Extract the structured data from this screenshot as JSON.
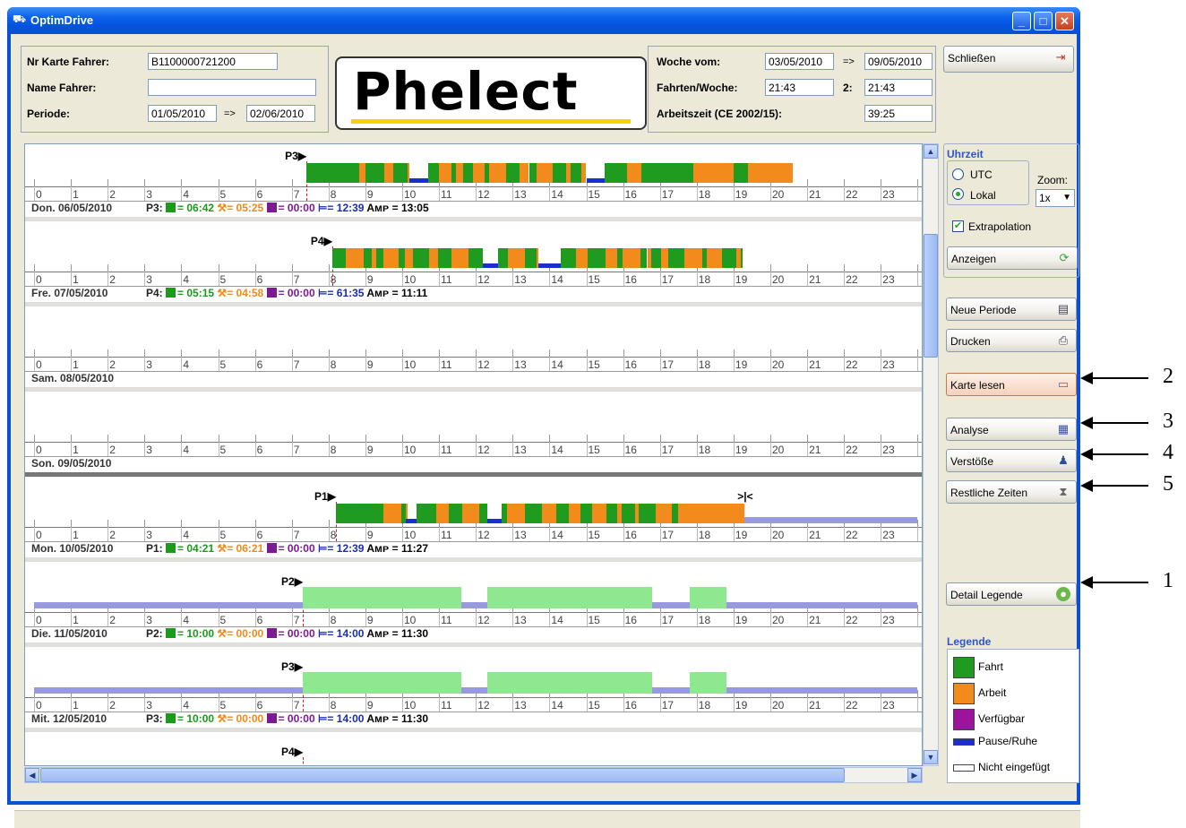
{
  "window": {
    "title": "OptimDrive"
  },
  "header": {
    "card_label": "Nr Karte Fahrer:",
    "card_value": "B1100000721200",
    "name_label": "Name Fahrer:",
    "name_value": "",
    "period_label": "Periode:",
    "period_from": "01/05/2010",
    "period_arrow": "=>",
    "period_to": "02/06/2010",
    "logo_text": "Phelect",
    "week_label": "Woche vom:",
    "week_from": "03/05/2010",
    "week_arrow": "=>",
    "week_to": "09/05/2010",
    "trips_label": "Fahrten/Woche:",
    "trips_value": "21:43",
    "trips2_label": "2:",
    "trips2_value": "21:43",
    "work_label": "Arbeitszeit (CE 2002/15):",
    "work_value": "39:25"
  },
  "sidebar": {
    "close_label": "Schließen",
    "uhrzeit_title": "Uhrzeit",
    "utc_label": "UTC",
    "lokal_label": "Lokal",
    "zoom_label": "Zoom:",
    "zoom_value": "1x",
    "extrapolation_label": "Extrapolation",
    "show_label": "Anzeigen",
    "new_period_label": "Neue Periode",
    "print_label": "Drucken",
    "read_card_label": "Karte lesen",
    "analysis_label": "Analyse",
    "violations_label": "Verstöße",
    "remaining_label": "Restliche Zeiten",
    "detail_legend_label": "Detail Legende",
    "legend_title": "Legende",
    "legend": [
      {
        "label": "Fahrt",
        "color": "#1f9b1f"
      },
      {
        "label": "Arbeit",
        "color": "#f28a1c"
      },
      {
        "label": "Verfügbar",
        "color": "#9b149b"
      },
      {
        "label": "Pause/Ruhe",
        "color": "#1a2fd0"
      },
      {
        "label": "Nicht eingefügt",
        "color": "#ffffff"
      }
    ]
  },
  "hours": [
    "0",
    "1",
    "2",
    "3",
    "4",
    "5",
    "6",
    "7",
    "8",
    "9",
    "10",
    "11",
    "12",
    "13",
    "14",
    "15",
    "16",
    "17",
    "18",
    "19",
    "20",
    "21",
    "22",
    "23"
  ],
  "days": [
    {
      "date": "Don. 06/05/2010",
      "code": "P3:",
      "marker": "P3",
      "drive": "= 06:42",
      "work": "= 05:25",
      "avail": "= 00:00",
      "rest": "= 12:39",
      "amp": "= 13:05"
    },
    {
      "date": "Fre. 07/05/2010",
      "code": "P4:",
      "marker": "P4",
      "drive": "= 05:15",
      "work": "= 04:58",
      "avail": "= 00:00",
      "rest": "= 61:35",
      "amp": "= 11:11"
    },
    {
      "date": "Sam. 08/05/2010"
    },
    {
      "date": "Son. 09/05/2010"
    },
    {
      "date": "Mon. 10/05/2010",
      "code": "P1:",
      "marker": "P1",
      "drive": "= 04:21",
      "work": "= 06:21",
      "avail": "= 00:00",
      "rest": "= 12:39",
      "amp": "= 11:27"
    },
    {
      "date": "Die. 11/05/2010",
      "code": "P2:",
      "marker": "P2",
      "drive": "= 10:00",
      "work": "= 00:00",
      "avail": "= 00:00",
      "rest": "= 14:00",
      "amp": "= 11:30"
    },
    {
      "date": "Mit. 12/05/2010",
      "code": "P3:",
      "marker": "P3",
      "drive": "= 10:00",
      "work": "= 00:00",
      "avail": "= 00:00",
      "rest": "= 14:00",
      "amp": "= 11:30"
    },
    {
      "marker": "P4"
    }
  ],
  "amp_label": "Aᴍᴘ",
  "callouts": [
    "2",
    "3",
    "4",
    "5",
    "1"
  ]
}
